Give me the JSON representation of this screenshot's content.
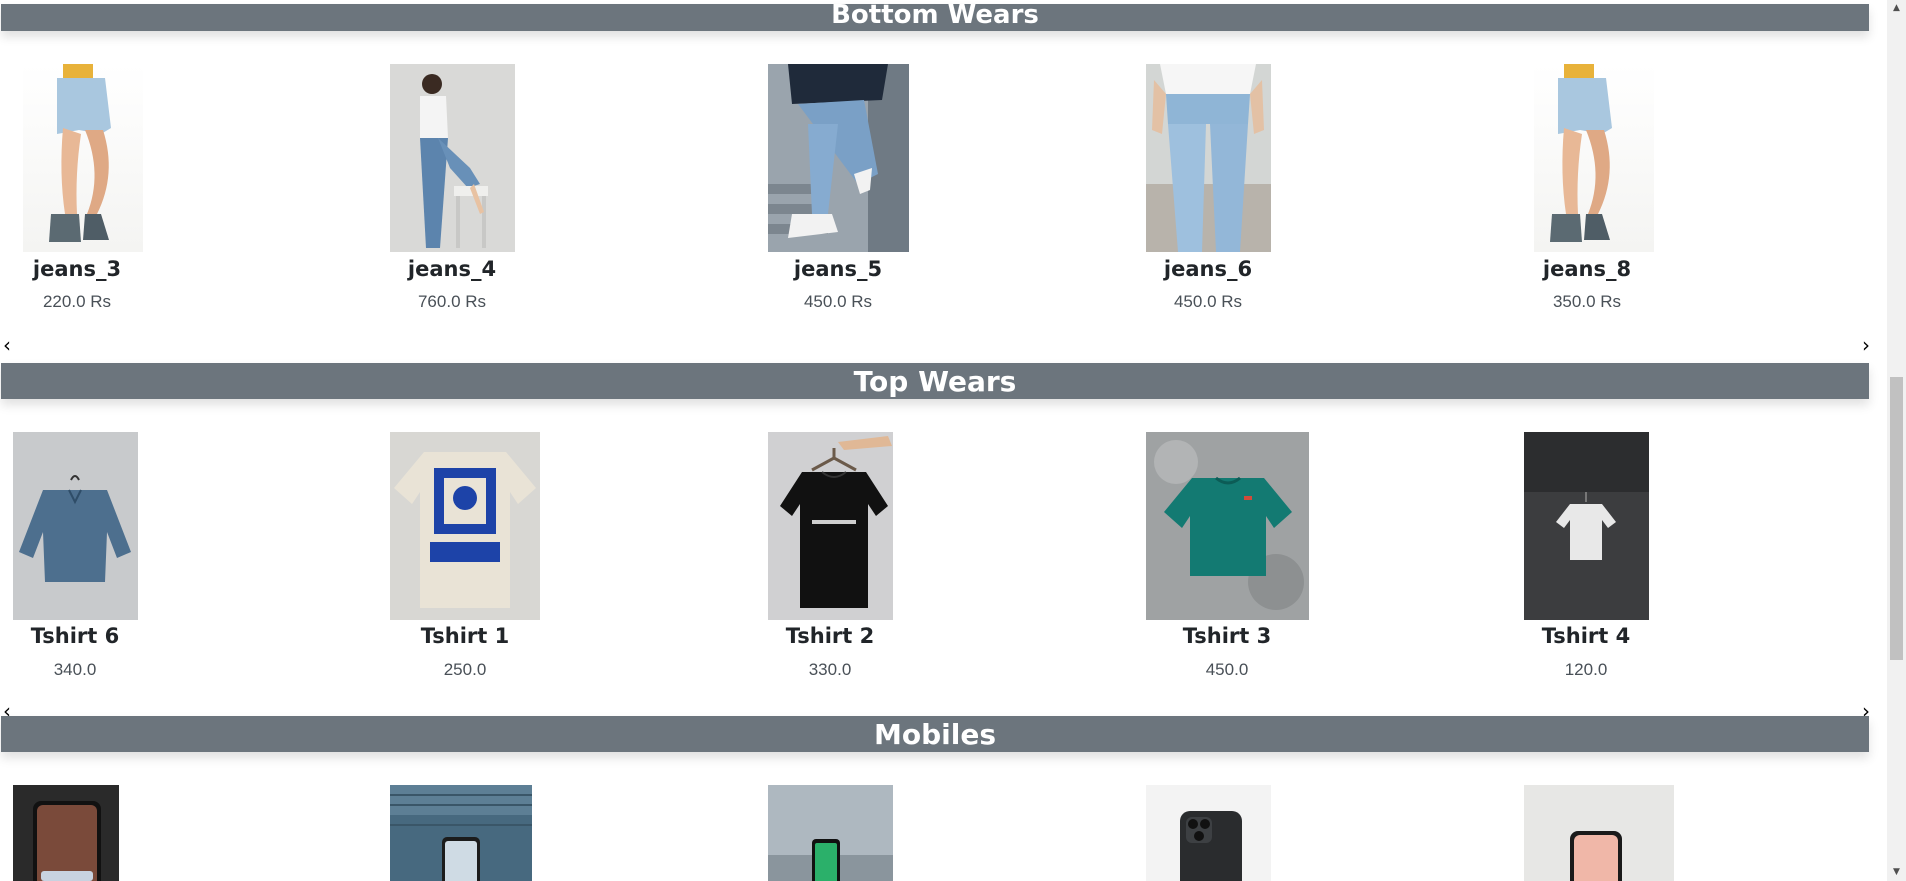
{
  "sections": {
    "bottom": {
      "title": "Bottom Wears",
      "items": [
        {
          "name": "jeans_3",
          "price": "220.0 Rs"
        },
        {
          "name": "jeans_4",
          "price": "760.0 Rs"
        },
        {
          "name": "jeans_5",
          "price": "450.0 Rs"
        },
        {
          "name": "jeans_6",
          "price": "450.0 Rs"
        },
        {
          "name": "jeans_8",
          "price": "350.0 Rs"
        }
      ]
    },
    "top": {
      "title": "Top Wears",
      "items": [
        {
          "name": "Tshirt 6",
          "price": "340.0"
        },
        {
          "name": "Tshirt 1",
          "price": "250.0"
        },
        {
          "name": "Tshirt 2",
          "price": "330.0"
        },
        {
          "name": "Tshirt 3",
          "price": "450.0"
        },
        {
          "name": "Tshirt 4",
          "price": "120.0"
        }
      ]
    },
    "mobiles": {
      "title": "Mobiles"
    }
  },
  "carousel": {
    "prev_glyph": "‹",
    "next_glyph": "›"
  },
  "scrollbar": {
    "up_glyph": "▲",
    "down_glyph": "▼"
  },
  "colors": {
    "header_bar": "#6c757d",
    "header_text": "#ffffff"
  }
}
